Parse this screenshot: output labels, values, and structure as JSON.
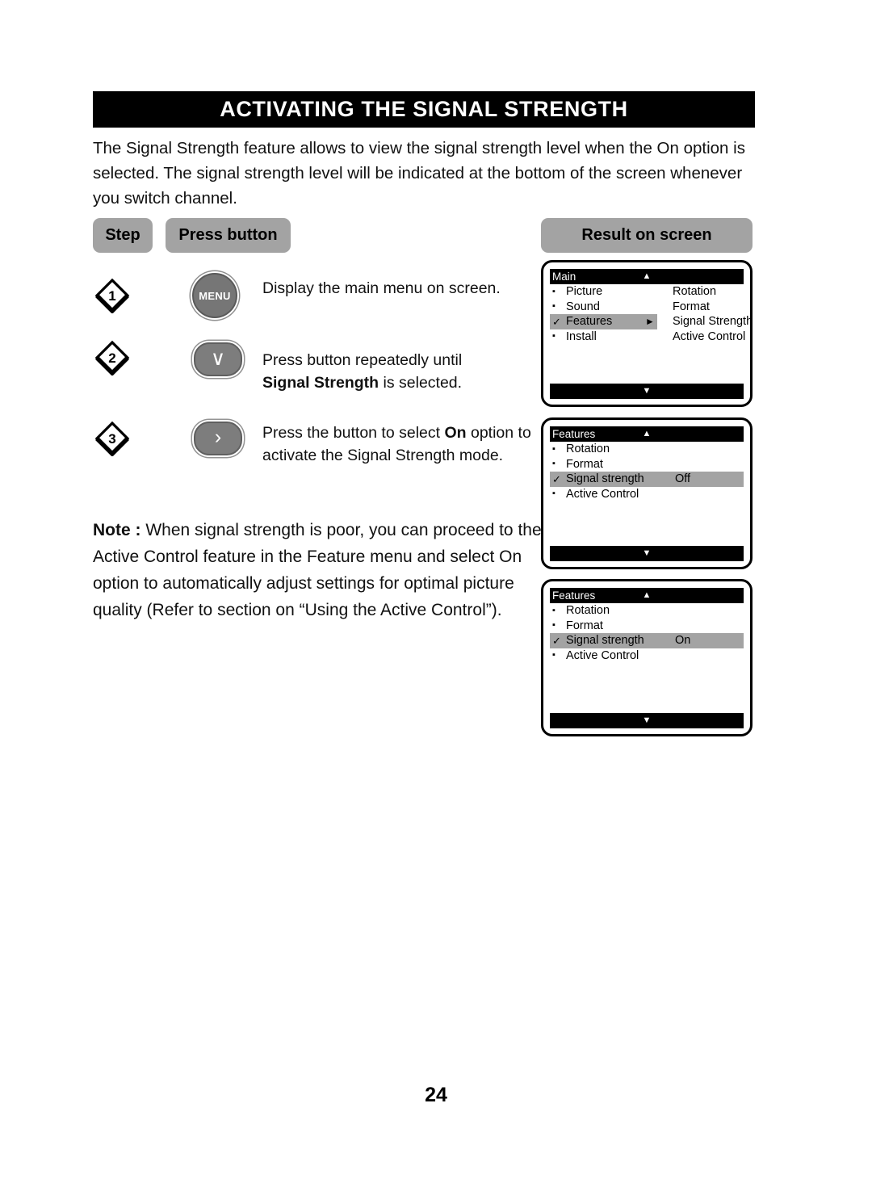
{
  "header": {
    "title": "ACTIVATING THE SIGNAL STRENGTH"
  },
  "intro": {
    "paragraph": "The Signal Strength feature allows to view the signal strength level when the On option is selected. The signal strength level will be indicated at the bottom of the screen whenever you switch channel."
  },
  "table_headers": {
    "step": "Step",
    "press_button": "Press button",
    "result_on_screen": "Result on screen"
  },
  "steps": [
    {
      "number": "1",
      "button_label": "MENU",
      "button_icon": "menu-button-icon",
      "text_plain": "Display the main menu on screen.",
      "text_line1": "Display the main menu on screen.",
      "text_line2_pre": "",
      "text_line2_bold": "",
      "text_line2_post": ""
    },
    {
      "number": "2",
      "button_label": "∨",
      "button_icon": "chevron-down-icon",
      "text_line1": "Press button repeatedly until",
      "text_line2_bold": "Signal Strength",
      "text_line2_post": " is selected."
    },
    {
      "number": "3",
      "button_label": "›",
      "button_icon": "chevron-right-icon",
      "text_line1_pre": "Press the button to select ",
      "text_line1_bold": "On",
      "text_line1_post": " option to",
      "text_line2": "activate the Signal Strength mode."
    }
  ],
  "note": {
    "label": "Note :",
    "text": " When signal strength is poor, you can proceed to the Active Control feature in the Feature menu and select On option to automatically adjust settings for optimal picture quality (Refer to section on “Using the Active Control”)."
  },
  "screens": [
    {
      "title": "Main",
      "up_arrow": "▲",
      "down_arrow": "▼",
      "rows": [
        {
          "mark": "▪",
          "label": "Picture",
          "highlight": "none",
          "submark": ""
        },
        {
          "mark": "▪",
          "label": "Sound",
          "highlight": "none",
          "submark": ""
        },
        {
          "mark": "✓",
          "label": "Features",
          "highlight": "left",
          "submark": "►"
        },
        {
          "mark": "▪",
          "label": "Install",
          "highlight": "none",
          "submark": ""
        }
      ],
      "right_column": [
        "Rotation",
        "Format",
        "Signal Strength",
        "Active Control"
      ]
    },
    {
      "title": "Features",
      "up_arrow": "▲",
      "down_arrow": "▼",
      "rows": [
        {
          "mark": "▪",
          "label": "Rotation",
          "highlight": "none",
          "value": ""
        },
        {
          "mark": "▪",
          "label": "Format",
          "highlight": "none",
          "value": ""
        },
        {
          "mark": "✓",
          "label": "Signal strength",
          "highlight": "full",
          "value": "Off"
        },
        {
          "mark": "▪",
          "label": "Active Control",
          "highlight": "none",
          "value": ""
        }
      ],
      "right_column": []
    },
    {
      "title": "Features",
      "up_arrow": "▲",
      "down_arrow": "▼",
      "rows": [
        {
          "mark": "▪",
          "label": "Rotation",
          "highlight": "none",
          "value": ""
        },
        {
          "mark": "▪",
          "label": "Format",
          "highlight": "none",
          "value": ""
        },
        {
          "mark": "✓",
          "label": "Signal strength",
          "highlight": "full",
          "value": "On"
        },
        {
          "mark": "▪",
          "label": "Active Control",
          "highlight": "none",
          "value": ""
        }
      ],
      "right_column": []
    }
  ],
  "footer": {
    "page_number": "24"
  },
  "colors": {
    "banner_bg": "#000000",
    "pill_gray": "#a3a3a3",
    "button_gray": "#7d7d7d",
    "highlight_gray": "#a3a3a3"
  }
}
